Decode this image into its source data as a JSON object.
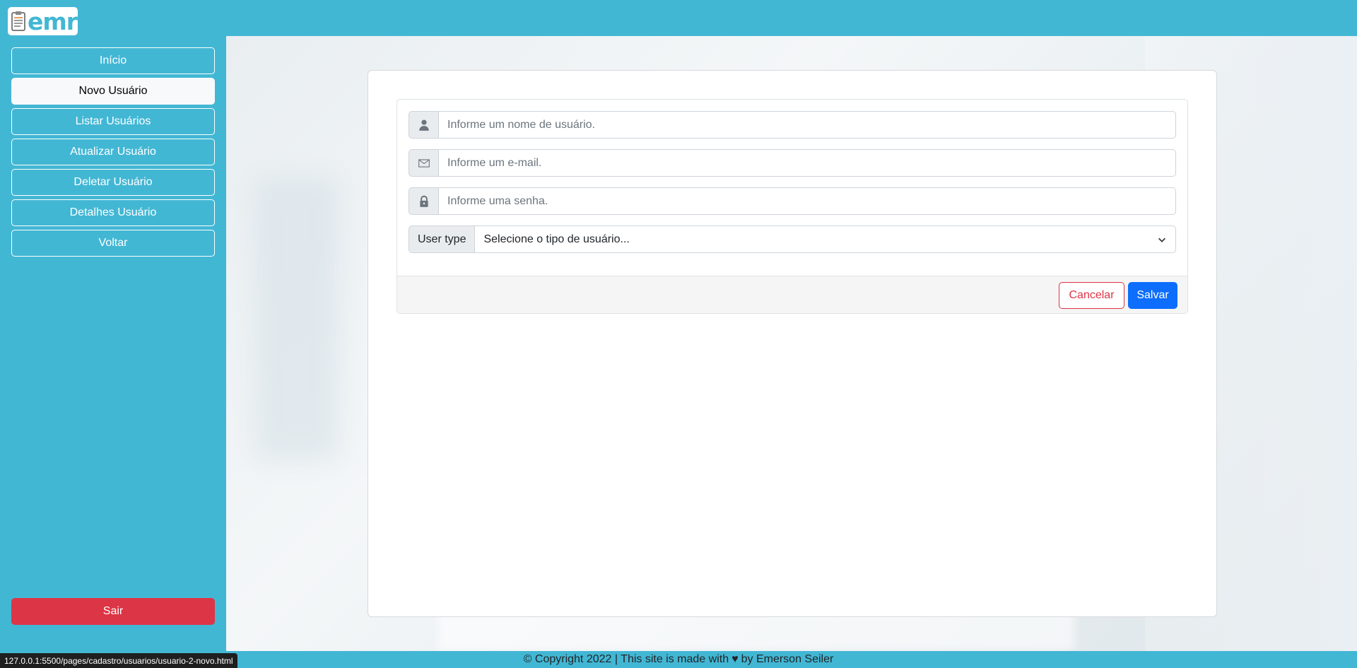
{
  "header": {
    "logo_text": "emr"
  },
  "sidebar": {
    "items": [
      {
        "label": "Início"
      },
      {
        "label": "Novo Usuário"
      },
      {
        "label": "Listar Usuários"
      },
      {
        "label": "Atualizar Usuário"
      },
      {
        "label": "Deletar Usuário"
      },
      {
        "label": "Detalhes Usuário"
      },
      {
        "label": "Voltar"
      }
    ],
    "logout_label": "Sair"
  },
  "form": {
    "username_placeholder": "Informe um nome de usuário.",
    "email_placeholder": "Informe um e-mail.",
    "password_placeholder": "Informe uma senha.",
    "user_type_label": "User type",
    "user_type_selected": "Selecione o tipo de usuário...",
    "cancel_label": "Cancelar",
    "save_label": "Salvar"
  },
  "footer": {
    "text_before": "© Copyright 2022 | This site is made with",
    "heart": "♥",
    "text_after": "by Emerson Seiler"
  },
  "status_bar": {
    "url": "127.0.0.1:5500/pages/cadastro/usuarios/usuario-2-novo.html"
  },
  "colors": {
    "accent": "#42b7d4",
    "danger": "#dc3545",
    "primary": "#0d6efd"
  },
  "icons": [
    "clipboard-icon",
    "user-icon",
    "envelope-icon",
    "lock-icon",
    "chevron-down-icon"
  ]
}
